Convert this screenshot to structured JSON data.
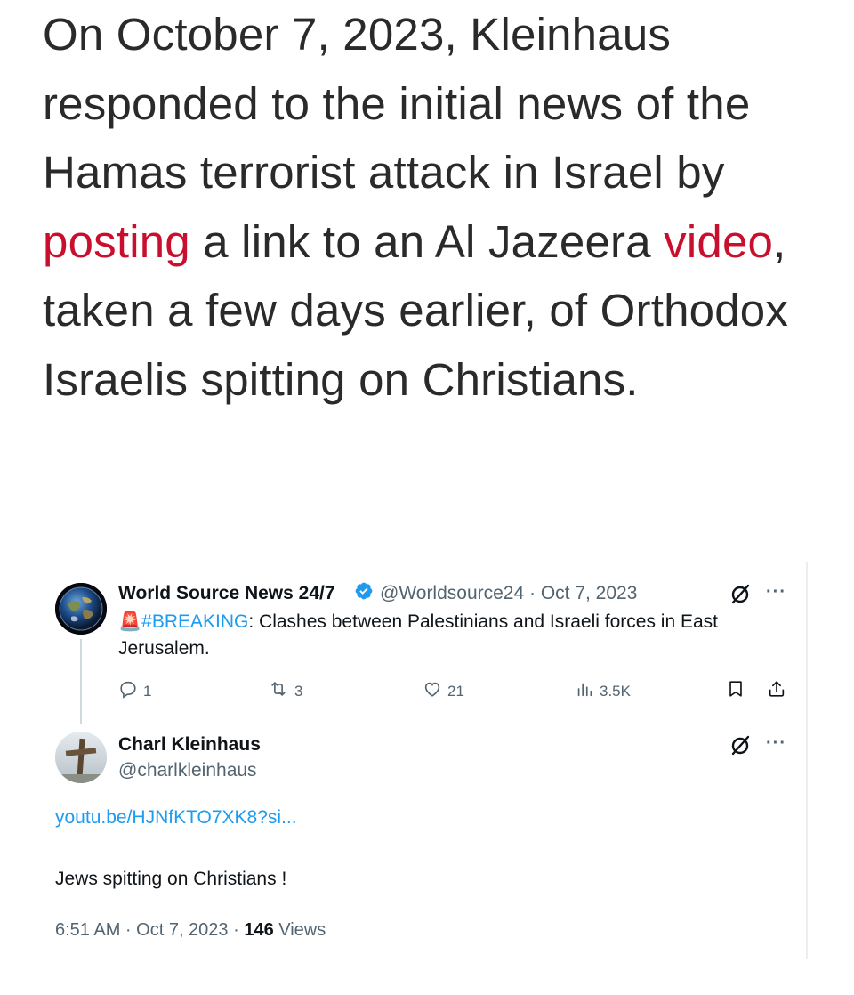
{
  "article": {
    "text_before_posting": "On October 7, 2023, Kleinhaus responded to the initial news of the Hamas terrorist attack in Israel by ",
    "posting_link": "posting",
    "text_between": " a link to an Al Jazeera ",
    "video_link": "video",
    "text_after": ", taken a few days earlier, of Orthodox Israelis spitting on Christians."
  },
  "tweet_original": {
    "name": "World Source News 24/7",
    "handle_date": "@Worldsource24 · Oct 7, 2023",
    "alarm_icon": "🚨",
    "hashtag": "#BREAKING",
    "body": ": Clashes between Palestinians and Israeli forces in East Jerusalem.",
    "replies": "1",
    "retweets": "3",
    "likes": "21",
    "views": "3.5K",
    "more_label": "···"
  },
  "tweet_reply": {
    "name": "Charl Kleinhaus",
    "handle": "@charlkleinhaus",
    "link": "youtu.be/HJNfKTO7XK8?si...",
    "body": "Jews spitting on Christians !",
    "time_date": "6:51 AM · Oct 7, 2023 · ",
    "views_count": "146",
    "views_label": " Views",
    "more_label": "···"
  },
  "colors": {
    "article_link": "#c8102e",
    "twitter_blue": "#1d9bf0",
    "muted": "#536471",
    "verified": "#1d9bf0"
  },
  "icons": [
    "grok-icon",
    "more-icon",
    "reply-icon",
    "retweet-icon",
    "like-icon",
    "views-icon",
    "bookmark-icon",
    "share-icon",
    "verified-badge-icon"
  ]
}
